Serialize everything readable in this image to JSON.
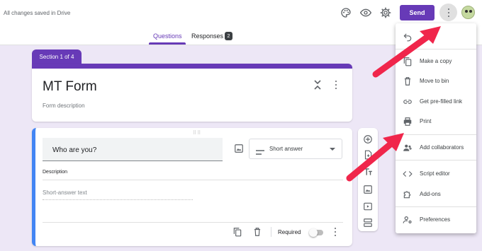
{
  "header": {
    "save_status": "All changes saved in Drive",
    "icons": [
      "palette-icon",
      "eye-icon",
      "gear-icon"
    ],
    "send_label": "Send",
    "more_icon": "more-vertical-icon"
  },
  "tabs": {
    "questions_label": "Questions",
    "responses_label": "Responses",
    "responses_count": "2"
  },
  "form": {
    "section_label": "Section 1 of 4",
    "title": "MT Form",
    "description_placeholder": "Form description"
  },
  "question": {
    "text": "Who are you?",
    "type": "Short answer",
    "description_label": "Description",
    "answer_placeholder": "Short-answer text",
    "required_label": "Required",
    "required": false
  },
  "menu": {
    "items": [
      {
        "label": "",
        "icon": "undo-icon"
      },
      {
        "label": "Make a copy",
        "icon": "copy-icon"
      },
      {
        "label": "Move to bin",
        "icon": "trash-icon"
      },
      {
        "label": "Get pre-filled link",
        "icon": "link-icon"
      },
      {
        "label": "Print",
        "icon": "print-icon"
      },
      {
        "label": "Add collaborators",
        "icon": "people-icon"
      },
      {
        "label": "Script editor",
        "icon": "code-icon"
      },
      {
        "label": "Add-ons",
        "icon": "puzzle-icon"
      },
      {
        "label": "Preferences",
        "icon": "person-settings-icon"
      }
    ]
  },
  "colors": {
    "accent": "#673ab7",
    "background": "#ede7f6",
    "active_question": "#4285f4",
    "annotation_arrow": "#f0264b"
  }
}
